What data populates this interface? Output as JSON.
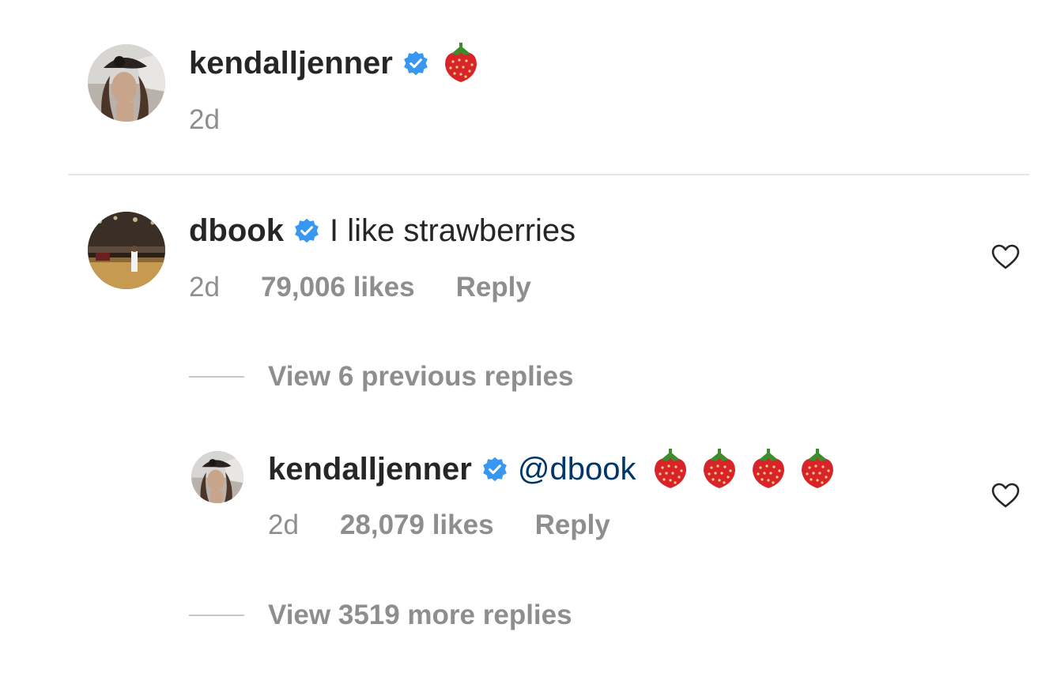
{
  "post_caption": {
    "username": "kendalljenner",
    "verified": true,
    "text_emoji": "strawberry",
    "time": "2d"
  },
  "comment": {
    "username": "dbook",
    "verified": true,
    "text": "I like strawberries",
    "time": "2d",
    "likes": "79,006 likes",
    "reply_label": "Reply"
  },
  "view_previous": {
    "label": "View 6 previous replies"
  },
  "reply": {
    "username": "kendalljenner",
    "verified": true,
    "mention": "@dbook",
    "emoji_count": 4,
    "emoji": "strawberry",
    "time": "2d",
    "likes": "28,079 likes",
    "reply_label": "Reply"
  },
  "view_more": {
    "label": "View 3519 more replies"
  },
  "colors": {
    "primary_text": "#262626",
    "secondary_text": "#8e8e8e",
    "verified_blue": "#3897f0",
    "mention_blue": "#00376b",
    "divider": "#e6e6e6"
  },
  "icons": [
    "verified-badge-icon",
    "strawberry-icon",
    "heart-icon"
  ]
}
